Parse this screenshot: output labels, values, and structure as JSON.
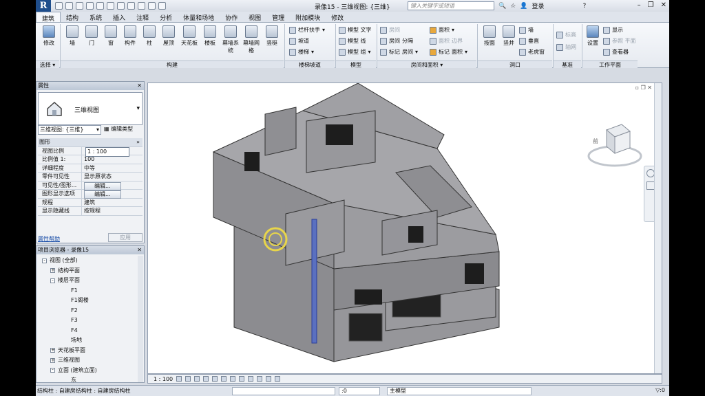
{
  "app": {
    "logo": "R",
    "window_title": "录像15 - 三维视图: {三维}",
    "search_placeholder": "键入关键字或短语",
    "login": "登录",
    "help": "?"
  },
  "tabs": [
    "建筑",
    "结构",
    "系统",
    "插入",
    "注释",
    "分析",
    "体量和场地",
    "协作",
    "视图",
    "管理",
    "附加模块",
    "修改"
  ],
  "ribbon": {
    "modify": "修改",
    "select": "选择 ▾",
    "build": [
      "墙",
      "门",
      "窗",
      "构件",
      "柱",
      "屋顶",
      "天花板",
      "楼板",
      "幕墙系统",
      "幕墙网格",
      "竖梃"
    ],
    "build_label": "构建",
    "circulation": [
      "栏杆扶手",
      "坡道",
      "楼梯"
    ],
    "circulation_label": "楼梯坡道",
    "model": [
      "模型 文字",
      "模型 线",
      "模型 组"
    ],
    "model_label": "模型",
    "room": [
      "房间",
      "分隔",
      "面积",
      "标记",
      "房间",
      "标记",
      "面积",
      "边界",
      "面积"
    ],
    "room_label": "房间和面积 ▾",
    "opening": [
      "按面",
      "竖井",
      "墙",
      "垂直",
      "老虎窗"
    ],
    "opening_label": "洞口",
    "datum": [
      "标高",
      "轴网"
    ],
    "datum_label": "基准",
    "workplane": [
      "设置",
      "显示",
      "参照 平面",
      "查看器"
    ],
    "workplane_label": "工作平面"
  },
  "properties": {
    "title": "属性",
    "type_name": "三维视图",
    "type_select": "三维视图: {三维}",
    "edit_type": "编辑类型",
    "group": "图形",
    "rows": [
      {
        "k": "视图比例",
        "v": "1 : 100"
      },
      {
        "k": "比例值 1:",
        "v": "100"
      },
      {
        "k": "详细程度",
        "v": "中等"
      },
      {
        "k": "零件可见性",
        "v": "显示原状态"
      },
      {
        "k": "可见性/图形...",
        "v": "编辑..."
      },
      {
        "k": "图形显示选项",
        "v": "编辑..."
      },
      {
        "k": "规程",
        "v": "建筑"
      },
      {
        "k": "显示隐藏线",
        "v": "按规程"
      }
    ],
    "help": "属性帮助",
    "apply": "应用"
  },
  "browser": {
    "title": "项目浏览器 - 录像15",
    "items": [
      {
        "t": "视图 (全部)",
        "lvl": 0,
        "g": "-"
      },
      {
        "t": "结构平面",
        "lvl": 1,
        "g": "+"
      },
      {
        "t": "楼层平面",
        "lvl": 1,
        "g": "-"
      },
      {
        "t": "F1",
        "lvl": 2,
        "g": ""
      },
      {
        "t": "F1阁楼",
        "lvl": 2,
        "g": ""
      },
      {
        "t": "F2",
        "lvl": 2,
        "g": ""
      },
      {
        "t": "F3",
        "lvl": 2,
        "g": ""
      },
      {
        "t": "F4",
        "lvl": 2,
        "g": ""
      },
      {
        "t": "场地",
        "lvl": 2,
        "g": ""
      },
      {
        "t": "天花板平面",
        "lvl": 1,
        "g": "+"
      },
      {
        "t": "三维视图",
        "lvl": 1,
        "g": "+"
      },
      {
        "t": "立面 (建筑立面)",
        "lvl": 1,
        "g": "-"
      },
      {
        "t": "东",
        "lvl": 2,
        "g": ""
      }
    ]
  },
  "viewcube": {
    "label": "前"
  },
  "view_status": {
    "scale": "1 : 100"
  },
  "statusbar": {
    "text": "结构柱 : 自建房结构柱 : 自建房结构柱",
    "workset": ":0",
    "model": "主模型"
  }
}
